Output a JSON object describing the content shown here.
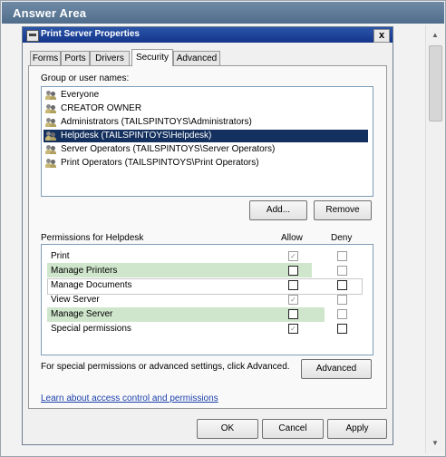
{
  "answer_area": {
    "title": "Answer Area"
  },
  "scrollbar": {
    "up_arrow": "▲",
    "down_arrow": "▼"
  },
  "dialog": {
    "title": "Print Server Properties",
    "close_glyph": "x",
    "tabs": [
      "Forms",
      "Ports",
      "Drivers",
      "Security",
      "Advanced"
    ],
    "active_tab": "Security",
    "group_label": "Group or user names:",
    "users": [
      "Everyone",
      "CREATOR OWNER",
      "Administrators (TAILSPINTOYS\\Administrators)",
      "Helpdesk (TAILSPINTOYS\\Helpdesk)",
      "Server Operators (TAILSPINTOYS\\Server Operators)",
      "Print Operators (TAILSPINTOYS\\Print Operators)"
    ],
    "selected_user": "Helpdesk (TAILSPINTOYS\\Helpdesk)",
    "add_button": "Add...",
    "remove_button": "Remove",
    "permissions_label": "Permissions for Helpdesk",
    "allow_header": "Allow",
    "deny_header": "Deny",
    "permissions": [
      {
        "name": "Print",
        "allow": true,
        "deny": false,
        "allow_state": "checked-disabled",
        "deny_state": "disabled",
        "highlight": false
      },
      {
        "name": "Manage Printers",
        "allow": false,
        "deny": false,
        "allow_state": "empty",
        "deny_state": "disabled",
        "highlight": true
      },
      {
        "name": "Manage Documents",
        "allow": false,
        "deny": false,
        "allow_state": "empty",
        "deny_state": "empty",
        "highlight": false
      },
      {
        "name": "View Server",
        "allow": true,
        "deny": false,
        "allow_state": "checked-disabled",
        "deny_state": "disabled",
        "highlight": false
      },
      {
        "name": "Manage Server",
        "allow": false,
        "deny": false,
        "allow_state": "empty",
        "deny_state": "disabled",
        "highlight": true
      },
      {
        "name": "Special permissions",
        "allow": true,
        "deny": false,
        "allow_state": "checked-disabled",
        "deny_state": "empty",
        "highlight": false
      }
    ],
    "special_text": "For special permissions or advanced settings, click Advanced.",
    "advanced_button": "Advanced",
    "learn_link": "Learn about access control and permissions",
    "ok_button": "OK",
    "cancel_button": "Cancel",
    "apply_button": "Apply"
  },
  "colors": {
    "header_bg": "#5a7896",
    "titlebar_bg": "#1f4496",
    "selection_bg": "#14305e",
    "highlight_green": "#cfe6cc",
    "link": "#1a3faa"
  }
}
